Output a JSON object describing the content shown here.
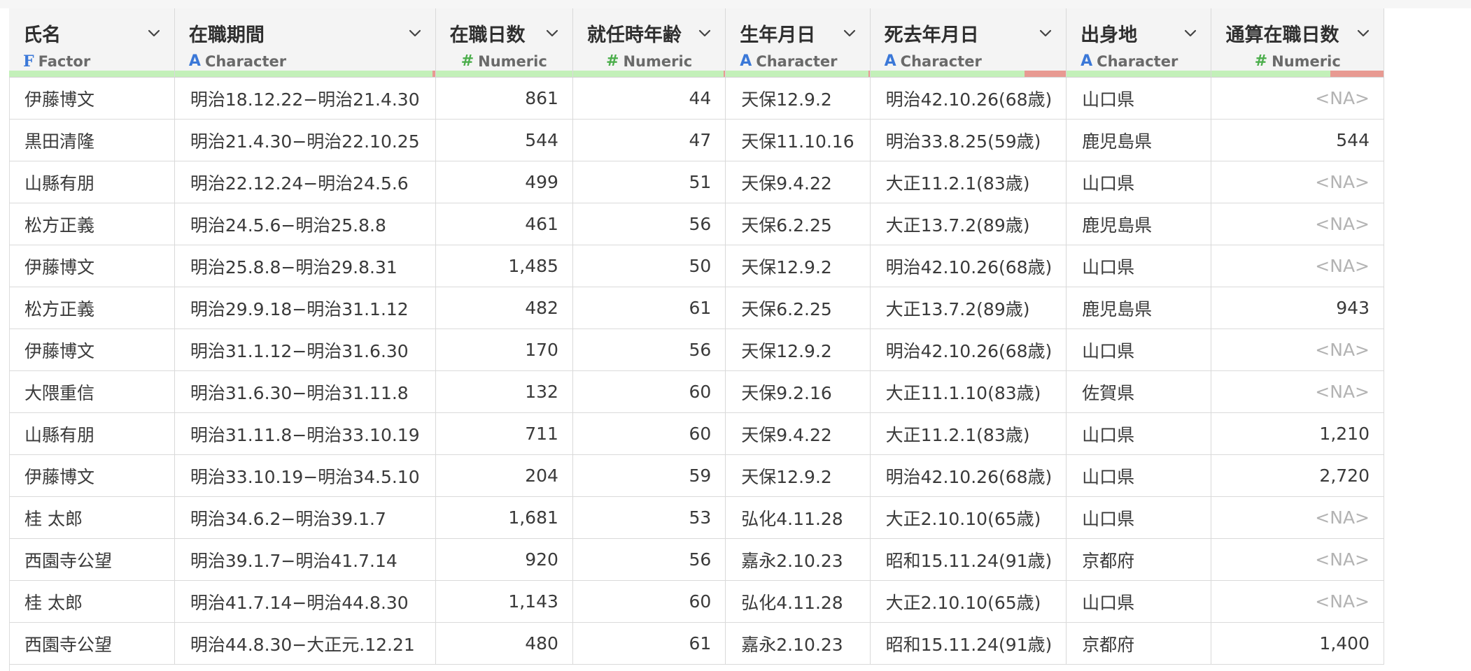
{
  "columns": [
    {
      "key": "name",
      "title": "氏名",
      "type_label": "Factor",
      "type_icon": "F",
      "type_kind": "factor",
      "width": 236,
      "align": "left",
      "quality_bad": 0
    },
    {
      "key": "period",
      "title": "在職期間",
      "type_label": "Character",
      "type_icon": "A",
      "type_kind": "character",
      "width": 372,
      "align": "left",
      "quality_bad": 0.01
    },
    {
      "key": "days",
      "title": "在職日数",
      "type_label": "Numeric",
      "type_icon": "#",
      "type_kind": "numeric",
      "width": 196,
      "align": "right",
      "quality_bad": 0
    },
    {
      "key": "age",
      "title": "就任時年齢",
      "type_label": "Numeric",
      "type_icon": "#",
      "type_kind": "numeric",
      "width": 218,
      "align": "right",
      "quality_bad": 0.01
    },
    {
      "key": "birth",
      "title": "生年月日",
      "type_label": "Character",
      "type_icon": "A",
      "type_kind": "character",
      "width": 206,
      "align": "left",
      "quality_bad": 0.01
    },
    {
      "key": "death",
      "title": "死去年月日",
      "type_label": "Character",
      "type_icon": "A",
      "type_kind": "character",
      "width": 280,
      "align": "left",
      "quality_bad": 0.21
    },
    {
      "key": "origin",
      "title": "出身地",
      "type_label": "Character",
      "type_icon": "A",
      "type_kind": "character",
      "width": 207,
      "align": "left",
      "quality_bad": 0
    },
    {
      "key": "total_days",
      "title": "通算在職日数",
      "type_label": "Numeric",
      "type_icon": "#",
      "type_kind": "numeric",
      "width": 246,
      "align": "right",
      "quality_bad": 0.31
    }
  ],
  "rows": [
    {
      "name": "伊藤博文",
      "period": "明治18.12.22−明治21.4.30",
      "days": "861",
      "age": "44",
      "birth": "天保12.9.2",
      "death": "明治42.10.26(68歳)",
      "origin": "山口県",
      "total_days": "<NA>"
    },
    {
      "name": "黒田清隆",
      "period": "明治21.4.30−明治22.10.25",
      "days": "544",
      "age": "47",
      "birth": "天保11.10.16",
      "death": "明治33.8.25(59歳)",
      "origin": "鹿児島県",
      "total_days": "544"
    },
    {
      "name": "山縣有朋",
      "period": "明治22.12.24−明治24.5.6",
      "days": "499",
      "age": "51",
      "birth": "天保9.4.22",
      "death": "大正11.2.1(83歳)",
      "origin": "山口県",
      "total_days": "<NA>"
    },
    {
      "name": "松方正義",
      "period": "明治24.5.6−明治25.8.8",
      "days": "461",
      "age": "56",
      "birth": "天保6.2.25",
      "death": "大正13.7.2(89歳)",
      "origin": "鹿児島県",
      "total_days": "<NA>"
    },
    {
      "name": "伊藤博文",
      "period": "明治25.8.8−明治29.8.31",
      "days": "1,485",
      "age": "50",
      "birth": "天保12.9.2",
      "death": "明治42.10.26(68歳)",
      "origin": "山口県",
      "total_days": "<NA>"
    },
    {
      "name": "松方正義",
      "period": "明治29.9.18−明治31.1.12",
      "days": "482",
      "age": "61",
      "birth": "天保6.2.25",
      "death": "大正13.7.2(89歳)",
      "origin": "鹿児島県",
      "total_days": "943"
    },
    {
      "name": "伊藤博文",
      "period": "明治31.1.12−明治31.6.30",
      "days": "170",
      "age": "56",
      "birth": "天保12.9.2",
      "death": "明治42.10.26(68歳)",
      "origin": "山口県",
      "total_days": "<NA>"
    },
    {
      "name": "大隈重信",
      "period": "明治31.6.30−明治31.11.8",
      "days": "132",
      "age": "60",
      "birth": "天保9.2.16",
      "death": "大正11.1.10(83歳)",
      "origin": "佐賀県",
      "total_days": "<NA>"
    },
    {
      "name": "山縣有朋",
      "period": "明治31.11.8−明治33.10.19",
      "days": "711",
      "age": "60",
      "birth": "天保9.4.22",
      "death": "大正11.2.1(83歳)",
      "origin": "山口県",
      "total_days": "1,210"
    },
    {
      "name": "伊藤博文",
      "period": "明治33.10.19−明治34.5.10",
      "days": "204",
      "age": "59",
      "birth": "天保12.9.2",
      "death": "明治42.10.26(68歳)",
      "origin": "山口県",
      "total_days": "2,720"
    },
    {
      "name": "桂 太郎",
      "period": "明治34.6.2−明治39.1.7",
      "days": "1,681",
      "age": "53",
      "birth": "弘化4.11.28",
      "death": "大正2.10.10(65歳)",
      "origin": "山口県",
      "total_days": "<NA>"
    },
    {
      "name": "西園寺公望",
      "period": "明治39.1.7−明治41.7.14",
      "days": "920",
      "age": "56",
      "birth": "嘉永2.10.23",
      "death": "昭和15.11.24(91歳)",
      "origin": "京都府",
      "total_days": "<NA>"
    },
    {
      "name": "桂 太郎",
      "period": "明治41.7.14−明治44.8.30",
      "days": "1,143",
      "age": "60",
      "birth": "弘化4.11.28",
      "death": "大正2.10.10(65歳)",
      "origin": "山口県",
      "total_days": "<NA>"
    },
    {
      "name": "西園寺公望",
      "period": "明治44.8.30−大正元.12.21",
      "days": "480",
      "age": "61",
      "birth": "嘉永2.10.23",
      "death": "昭和15.11.24(91歳)",
      "origin": "京都府",
      "total_days": "1,400"
    }
  ],
  "na_token": "<NA>",
  "colors": {
    "quality_ok": "#c3f0b9",
    "quality_bad": "#e89a92",
    "type_text_icon": "#3b78d8",
    "type_numeric_icon": "#4cae4c"
  },
  "icons": {
    "column_menu": "chevron-down-icon"
  }
}
